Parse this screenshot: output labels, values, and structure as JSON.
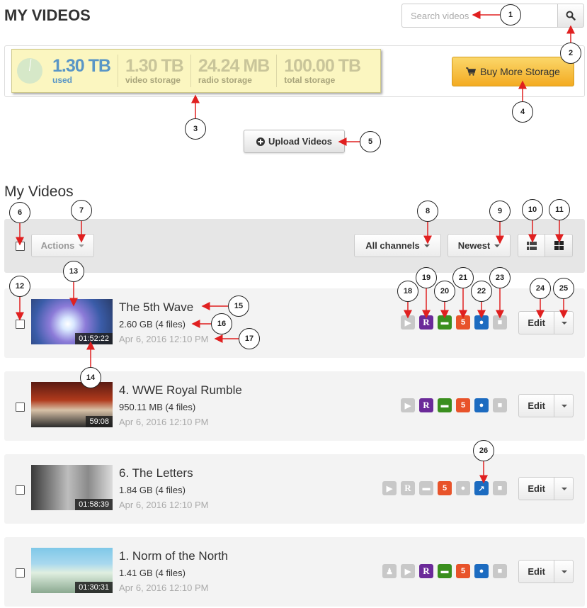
{
  "header": {
    "title": "MY VIDEOS"
  },
  "search": {
    "placeholder": "Search videos"
  },
  "storage": {
    "stats": [
      {
        "value": "1.30 TB",
        "label": "used"
      },
      {
        "value": "1.30 TB",
        "label": "video storage"
      },
      {
        "value": "24.24 MB",
        "label": "radio storage"
      },
      {
        "value": "100.00 TB",
        "label": "total storage"
      }
    ],
    "buy_label": "Buy More Storage"
  },
  "upload": {
    "label": "Upload Videos"
  },
  "section": {
    "title": "My Videos"
  },
  "toolbar": {
    "actions_label": "Actions",
    "channels_label": "All channels",
    "sort_label": "Newest"
  },
  "videos": [
    {
      "title": "The 5th Wave",
      "size": "2.60 GB",
      "files": "(4 files)",
      "date": "Apr 6, 2016 12:10 PM",
      "duration": "01:52:22",
      "edit_label": "Edit"
    },
    {
      "title": "4. WWE Royal Rumble",
      "size": "950.11 MB",
      "files": "(4 files)",
      "date": "Apr 6, 2016 12:10 PM",
      "duration": "59:08",
      "edit_label": "Edit"
    },
    {
      "title": "6. The Letters",
      "size": "1.84 GB",
      "files": "(4 files)",
      "date": "Apr 6, 2016 12:10 PM",
      "duration": "01:58:39",
      "edit_label": "Edit"
    },
    {
      "title": "1. Norm of the North",
      "size": "1.41 GB",
      "files": "(4 files)",
      "date": "Apr 6, 2016 12:10 PM",
      "duration": "01:30:31",
      "edit_label": "Edit"
    }
  ],
  "badges": {
    "r_letter": "R"
  },
  "callouts": [
    "1",
    "2",
    "3",
    "4",
    "5",
    "6",
    "7",
    "8",
    "9",
    "10",
    "11",
    "12",
    "13",
    "14",
    "15",
    "16",
    "17",
    "18",
    "19",
    "20",
    "21",
    "22",
    "23",
    "24",
    "25",
    "26"
  ],
  "colors": {
    "accent_blue": "#5a96c6",
    "buy_button": "#f3ab22",
    "storage_bg": "#fbf6c0",
    "row_bg": "#f3f3f3",
    "toolbar_bg": "#e6e6e6",
    "arrow_red": "#e02020"
  },
  "icons": [
    "search-icon",
    "cart-icon",
    "plus-circle-icon",
    "caret-down-icon",
    "list-view-icon",
    "grid-view-icon",
    "youtube-icon",
    "roku-icon",
    "android-tv-icon",
    "html5-icon",
    "web-icon",
    "lock-icon",
    "external-link-icon",
    "group-icon"
  ]
}
